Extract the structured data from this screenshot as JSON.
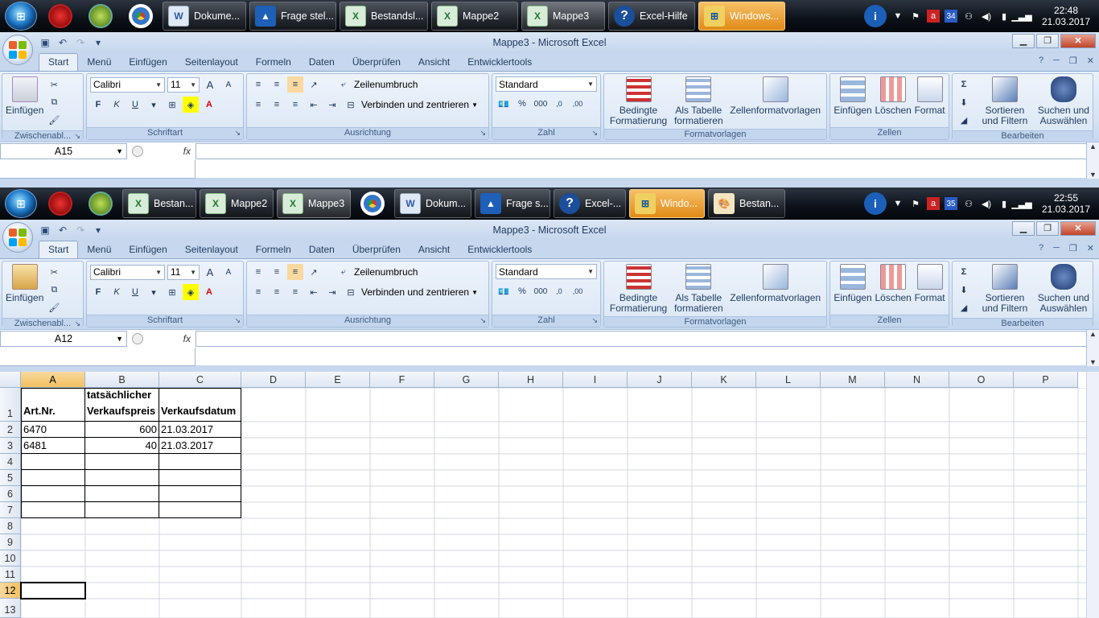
{
  "taskbar_top": {
    "buttons": [
      {
        "label": "Dokume...",
        "icon": "word-icon"
      },
      {
        "label": "Frage stel...",
        "icon": "navigation-icon"
      },
      {
        "label": "Bestandsl...",
        "icon": "excel-icon"
      },
      {
        "label": "Mappe2",
        "icon": "excel-icon"
      },
      {
        "label": "Mappe3",
        "icon": "excel-icon"
      },
      {
        "label": "Excel-Hilfe",
        "icon": "help-icon"
      },
      {
        "label": "Windows...",
        "icon": "windows-icon"
      }
    ],
    "badge": "34",
    "time": "22:48",
    "date": "21.03.2017"
  },
  "taskbar_bottom": {
    "buttons": [
      {
        "label": "Bestan...",
        "icon": "excel-icon"
      },
      {
        "label": "Mappe2",
        "icon": "excel-icon"
      },
      {
        "label": "Mappe3",
        "icon": "excel-icon"
      },
      {
        "label": "Dokum...",
        "icon": "word-icon"
      },
      {
        "label": "Frage s...",
        "icon": "navigation-icon"
      },
      {
        "label": "Excel-...",
        "icon": "help-icon"
      },
      {
        "label": "Windo...",
        "icon": "windows-icon"
      },
      {
        "label": "Bestan...",
        "icon": "paint-icon"
      }
    ],
    "badge": "35",
    "time": "22:55",
    "date": "21.03.2017"
  },
  "window": {
    "title": "Mappe3 - Microsoft Excel",
    "tabs": [
      "Start",
      "Menü",
      "Einfügen",
      "Seitenlayout",
      "Formeln",
      "Daten",
      "Überprüfen",
      "Ansicht",
      "Entwicklertools"
    ],
    "active_tab": "Start"
  },
  "ribbon": {
    "clipboard": {
      "paste": "Einfügen",
      "label": "Zwischenabl..."
    },
    "font": {
      "name": "Calibri",
      "size": "11",
      "bold": "F",
      "italic": "K",
      "underline": "U",
      "grow": "A",
      "shrink": "A",
      "label": "Schriftart"
    },
    "alignment": {
      "wrap": "Zeilenumbruch",
      "merge": "Verbinden und zentrieren",
      "label": "Ausrichtung"
    },
    "number": {
      "format": "Standard",
      "percent": "%",
      "thousands": "000",
      "inc_dec": ",0",
      "dec_dec": ",00",
      "label": "Zahl"
    },
    "styles": {
      "conditional_1": "Bedingte",
      "conditional_2": "Formatierung",
      "table_1": "Als Tabelle",
      "table_2": "formatieren",
      "cell_styles": "Zellenformatvorlagen",
      "label": "Formatvorlagen"
    },
    "cells": {
      "insert": "Einfügen",
      "delete": "Löschen",
      "format": "Format",
      "label": "Zellen"
    },
    "editing": {
      "sort_1": "Sortieren",
      "sort_2": "und Filtern",
      "find_1": "Suchen und",
      "find_2": "Auswählen",
      "label": "Bearbeiten",
      "sum": "Σ"
    }
  },
  "formula_bar_top": {
    "name_box": "A15",
    "fx": "fx",
    "value": ""
  },
  "formula_bar_bottom": {
    "name_box": "A12",
    "fx": "fx",
    "value": ""
  },
  "sheet": {
    "columns": [
      "A",
      "B",
      "C",
      "D",
      "E",
      "F",
      "G",
      "H",
      "I",
      "J",
      "K",
      "L",
      "M",
      "N",
      "O",
      "P"
    ],
    "rows": [
      "1",
      "2",
      "3",
      "4",
      "5",
      "6",
      "7",
      "8",
      "9",
      "10",
      "11",
      "12",
      "13"
    ],
    "header": {
      "a1": "Art.Nr.",
      "b1_line1": "tatsächlicher",
      "b1_line2": "Verkaufspreis",
      "c1": "Verkaufsdatum"
    },
    "data": [
      {
        "a": "6470",
        "b": "600",
        "c": "21.03.2017"
      },
      {
        "a": "6481",
        "b": "40",
        "c": "21.03.2017"
      }
    ],
    "selected_cell": "A12"
  },
  "colors": {
    "selection_header": "#f1c15f",
    "ribbon_bg": "#d4e2f4",
    "taskbar_bg": "#0c1118"
  }
}
